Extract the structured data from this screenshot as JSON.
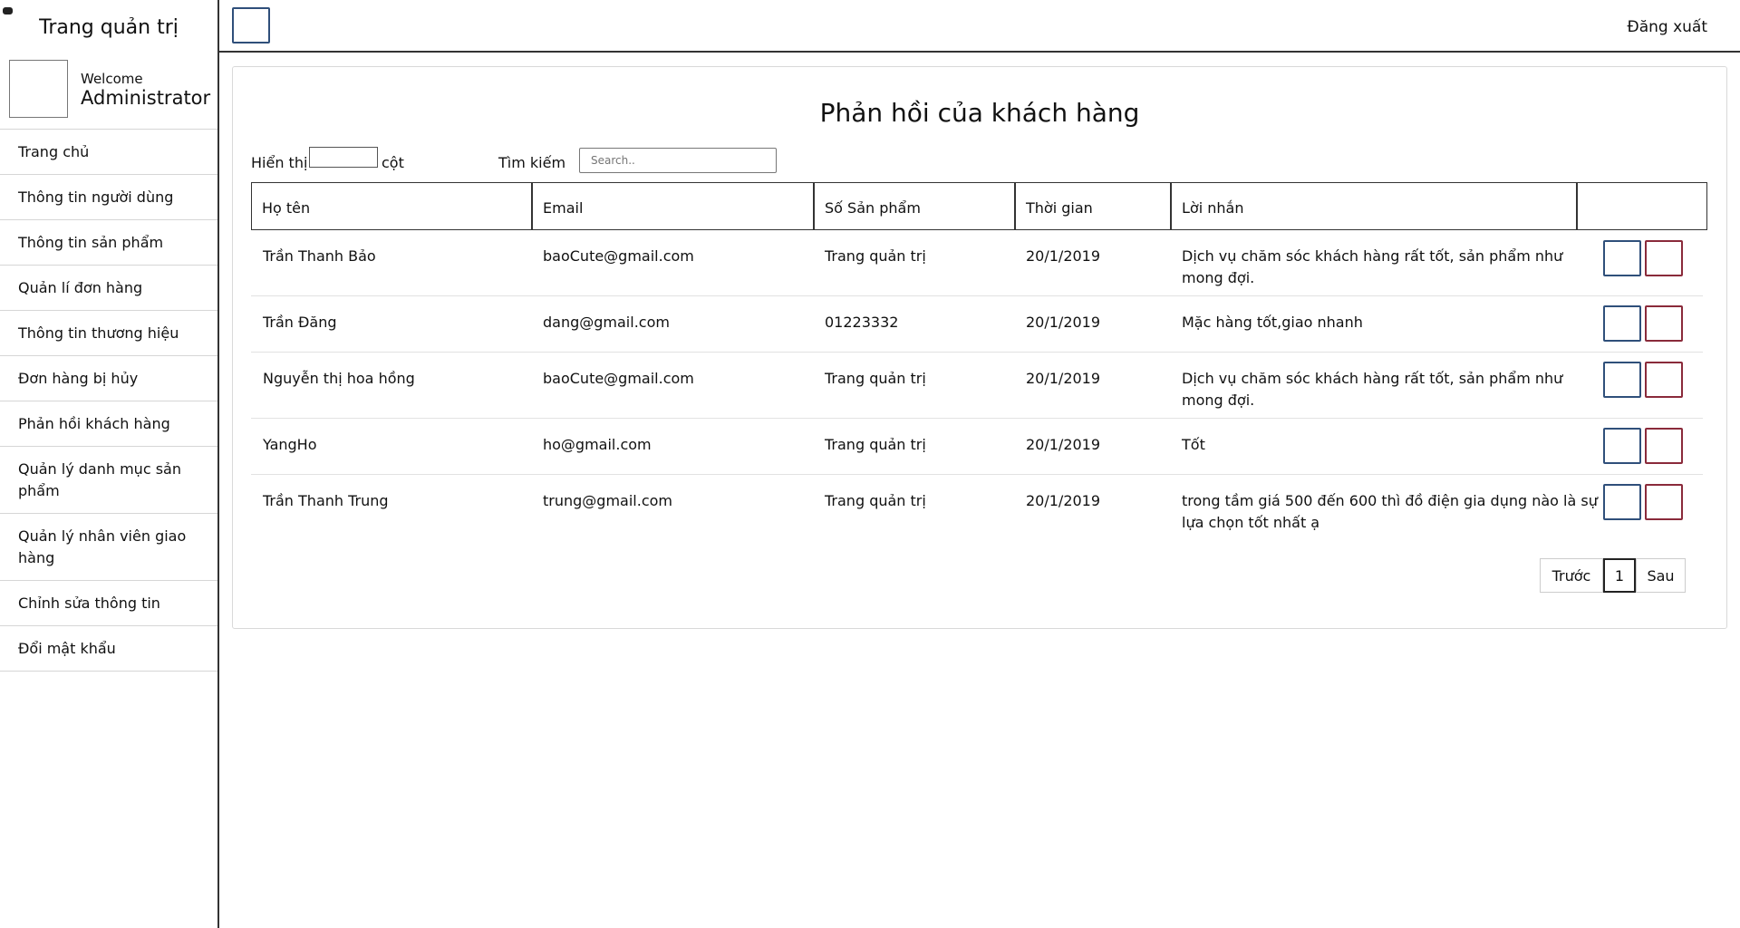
{
  "sidebar": {
    "title": "Trang quản trị",
    "welcome": "Welcome",
    "username": "Administrator",
    "items": [
      {
        "label": "Trang chủ"
      },
      {
        "label": "Thông tin người dùng"
      },
      {
        "label": "Thông tin sản phẩm"
      },
      {
        "label": "Quản lí đơn hàng"
      },
      {
        "label": "Thông tin thương hiệu"
      },
      {
        "label": "Đơn hàng bị hủy"
      },
      {
        "label": "Phản hồi khách hàng"
      },
      {
        "label": "Quản lý danh mục sản phẩm"
      },
      {
        "label": "Quản lý nhân viên giao hàng"
      },
      {
        "label": "Chỉnh sửa thông tin"
      },
      {
        "label": "Đổi mật khẩu"
      }
    ]
  },
  "topbar": {
    "logout": "Đăng xuất"
  },
  "main": {
    "title": "Phản hồi của khách hàng",
    "show_label": "Hiển thị",
    "cols_label": "cột",
    "search_label": "Tìm kiếm",
    "search_placeholder": "Search.."
  },
  "table": {
    "headers": [
      "Họ tên",
      "Email",
      "Số Sản phẩm",
      "Thời gian",
      "Lời nhắn",
      ""
    ],
    "rows": [
      {
        "name": "Trần Thanh Bảo",
        "email": "baoCute@gmail.com",
        "product": "Trang quản trị",
        "time": "20/1/2019",
        "message": "Dịch vụ chăm sóc khách hàng rất tốt, sản phẩm như mong đợi."
      },
      {
        "name": "Trần Đăng",
        "email": "dang@gmail.com",
        "product": "01223332",
        "time": "20/1/2019",
        "message": "Mặc hàng tốt,giao nhanh"
      },
      {
        "name": "Nguyễn thị hoa hồng",
        "email": "baoCute@gmail.com",
        "product": "Trang quản trị",
        "time": "20/1/2019",
        "message": "Dịch vụ chăm sóc khách hàng rất tốt, sản phẩm như mong đợi."
      },
      {
        "name": "YangHo",
        "email": "ho@gmail.com",
        "product": "Trang quản trị",
        "time": "20/1/2019",
        "message": "Tốt"
      },
      {
        "name": "Trần Thanh Trung",
        "email": "trung@gmail.com",
        "product": "Trang quản trị",
        "time": "20/1/2019",
        "message": "trong tầm giá 500 đến 600 thì đồ điện gia dụng nào là sự lựa chọn tốt nhất ạ"
      }
    ]
  },
  "pagination": {
    "prev": "Trước",
    "page": "1",
    "next": "Sau"
  },
  "colors": {
    "edit_border": "#2f4f7a",
    "delete_border": "#8a2a3a"
  }
}
